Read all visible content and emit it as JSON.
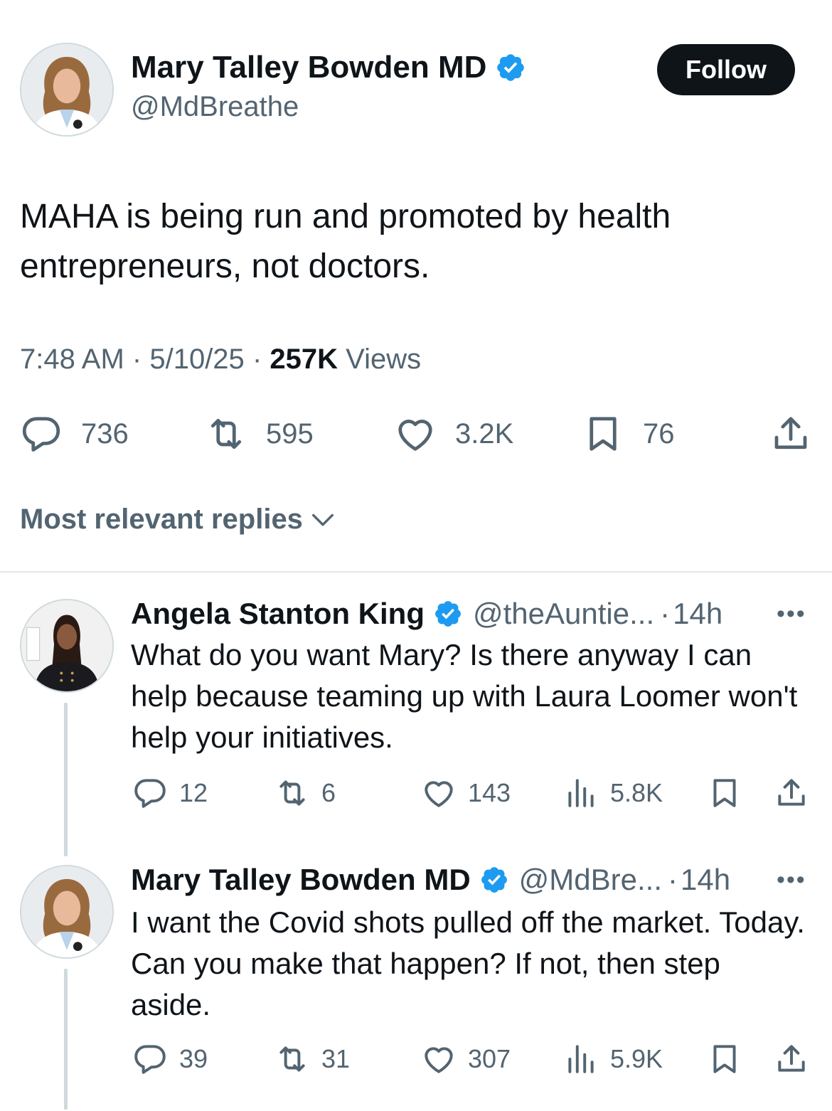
{
  "post": {
    "author_name": "Mary Talley Bowden MD",
    "handle": "@MdBreathe",
    "follow_label": "Follow",
    "text": "MAHA is being run and promoted by health entrepreneurs, not doctors.",
    "time": "7:48 AM",
    "sep1": "·",
    "date": "5/10/25",
    "sep2": "·",
    "views_count": "257K",
    "views_label": "Views",
    "replies": "736",
    "reposts": "595",
    "likes": "3.2K",
    "bookmarks": "76"
  },
  "sort": {
    "label": "Most relevant replies"
  },
  "replies": [
    {
      "author_name": "Angela Stanton King",
      "handle": "@theAuntie...",
      "sep": "·",
      "time": "14h",
      "more": "•••",
      "text": "What do you want Mary? Is there anyway I can help because teaming up with Laura Loomer won't help your initiatives.",
      "replies": "12",
      "reposts": "6",
      "likes": "143",
      "views": "5.8K"
    },
    {
      "author_name": "Mary Talley Bowden MD",
      "handle": "@MdBre...",
      "sep": "·",
      "time": "14h",
      "more": "•••",
      "text": "I want the Covid shots pulled off the market. Today.  Can you make that happen?  If not, then step aside.",
      "replies": "39",
      "reposts": "31",
      "likes": "307",
      "views": "5.9K"
    }
  ],
  "colors": {
    "text": "#0f1419",
    "muted": "#536471",
    "verified": "#1d9bf0",
    "divider": "#e1e8ed",
    "thread_line": "#cfd9de"
  },
  "icons": [
    "verified-badge-icon",
    "reply-icon",
    "repost-icon",
    "like-icon",
    "bookmark-icon",
    "share-icon",
    "views-icon",
    "chevron-down-icon",
    "more-icon"
  ]
}
